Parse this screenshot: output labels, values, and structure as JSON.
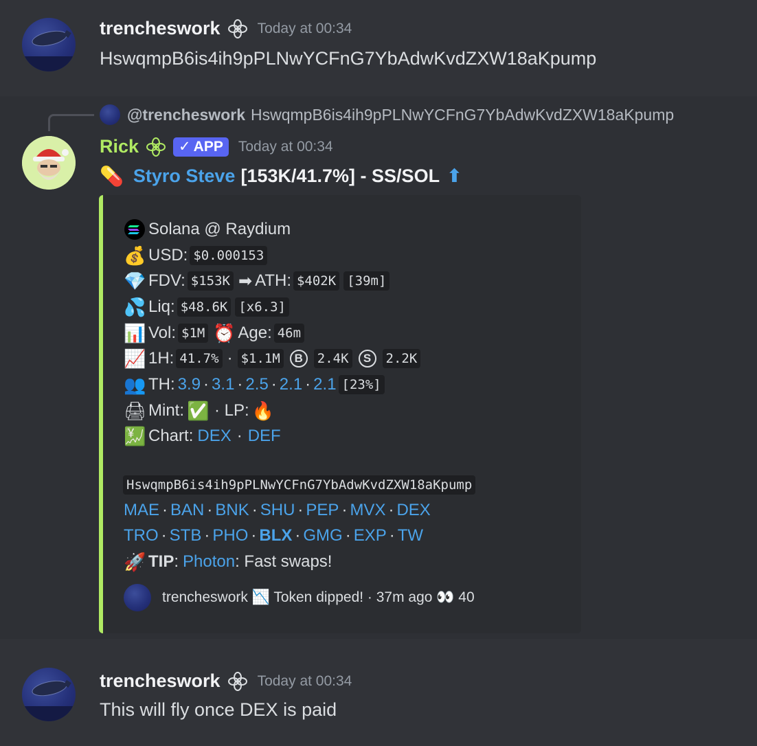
{
  "messages": [
    {
      "author": "trencheswork",
      "timestamp": "Today at 00:34",
      "text": "HswqmpB6is4ih9pPLNwYCFnG7YbAdwKvdZXW18aKpump"
    },
    {
      "author": "trencheswork",
      "timestamp": "Today at 00:34",
      "text": "This will fly once DEX is paid"
    }
  ],
  "reply": {
    "mention": "@trencheswork",
    "text": "HswqmpB6is4ih9pPLNwYCFnG7YbAdwKvdZXW18aKpump"
  },
  "bot": {
    "author": "Rick",
    "badge": "APP",
    "badge_check": "✓",
    "timestamp": "Today at 00:34",
    "title_emoji": "💊",
    "title_link": "Styro Steve",
    "title_rest": "[153K/41.7%] - SS/SOL",
    "title_arrow": "⬆"
  },
  "embed": {
    "accent_color": "#b0ea63",
    "chain": "Solana @ Raydium",
    "usd_label": "USD:",
    "usd_value": "$0.000153",
    "fdv_label": "FDV:",
    "fdv_value": "$153K",
    "ath_arrow": "➡",
    "ath_label": "ATH:",
    "ath_value": "$402K",
    "ath_time": "[39m]",
    "liq_label": "Liq:",
    "liq_value": "$48.6K",
    "liq_mult": "[x6.3]",
    "vol_label": "Vol:",
    "vol_value": "$1M",
    "age_label": "Age:",
    "age_value": "46m",
    "h1_label": "1H:",
    "h1_pct": "41.7%",
    "h1_sep": "·",
    "h1_vol": "$1.1M",
    "buy_letter": "B",
    "buys": "2.4K",
    "sell_letter": "S",
    "sells": "2.2K",
    "th_label": "TH:",
    "th_values": [
      "3.9",
      "3.1",
      "2.5",
      "2.1",
      "2.1"
    ],
    "th_total": "[23%]",
    "mint_label": "Mint:",
    "mint_status": "✅",
    "lp_label": "· LP:",
    "lp_status": "🔥",
    "chart_label": "Chart:",
    "chart_links": [
      "DEX",
      "DEF"
    ],
    "address": "HswqmpB6is4ih9pPLNwYCFnG7YbAdwKvdZXW18aKpump",
    "links_row1": [
      "MAE",
      "BAN",
      "BNK",
      "SHU",
      "PEP",
      "MVX",
      "DEX"
    ],
    "links_row2": [
      "TRO",
      "STB",
      "PHO",
      "BLX",
      "GMG",
      "EXP",
      "TW"
    ],
    "tip_label": "TIP",
    "tip_colon": ":",
    "tip_link": "Photon",
    "tip_text": ": Fast swaps!",
    "footer": "trencheswork 📉 Token dipped! · 37m ago 👀 40"
  },
  "emoji_icons": {
    "usd": "💰",
    "fdv": "💎",
    "liq": "💦",
    "vol": "📊",
    "age": "⏰",
    "h1": "📈",
    "th": "👥",
    "mint": "🖨",
    "chart": "💹",
    "tip": "🚀"
  }
}
